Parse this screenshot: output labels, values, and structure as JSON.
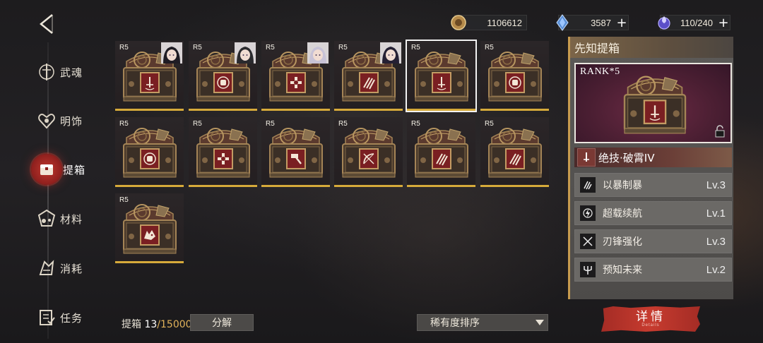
{
  "header": {
    "currencies": [
      {
        "icon": "coin-icon",
        "value": "1106612",
        "has_plus": false
      },
      {
        "icon": "crystal-icon",
        "value": "3587",
        "has_plus": true
      },
      {
        "icon": "stamina-icon",
        "value": "110/240",
        "has_plus": true
      }
    ]
  },
  "sidebar": {
    "items": [
      {
        "label": "武魂",
        "icon": "warrior-soul-icon",
        "active": false
      },
      {
        "label": "明饰",
        "icon": "ornament-icon",
        "active": false
      },
      {
        "label": "提箱",
        "icon": "chest-icon",
        "active": true
      },
      {
        "label": "材料",
        "icon": "materials-icon",
        "active": false
      },
      {
        "label": "消耗",
        "icon": "consumable-icon",
        "active": false
      },
      {
        "label": "任务",
        "icon": "task-icon",
        "active": false
      }
    ]
  },
  "grid": {
    "cards": [
      {
        "rank": "R5",
        "emblem": "sword",
        "portrait": true
      },
      {
        "rank": "R5",
        "emblem": "fist",
        "portrait": true
      },
      {
        "rank": "R5",
        "emblem": "cross",
        "portrait": true
      },
      {
        "rank": "R5",
        "emblem": "slash",
        "portrait": true
      },
      {
        "rank": "R5",
        "emblem": "sword",
        "portrait": false,
        "selected": true
      },
      {
        "rank": "R5",
        "emblem": "fist",
        "portrait": false
      },
      {
        "rank": "R5",
        "emblem": "fist",
        "portrait": false
      },
      {
        "rank": "R5",
        "emblem": "cross",
        "portrait": false
      },
      {
        "rank": "R5",
        "emblem": "hammer",
        "portrait": false
      },
      {
        "rank": "R5",
        "emblem": "bow",
        "portrait": false
      },
      {
        "rank": "R5",
        "emblem": "slash",
        "portrait": false
      },
      {
        "rank": "R5",
        "emblem": "slash",
        "portrait": false
      },
      {
        "rank": "R5",
        "emblem": "wolf",
        "portrait": false
      }
    ]
  },
  "footer": {
    "count_label": "提箱",
    "count_current": "13",
    "count_max": "/15000",
    "decompose_label": "分解",
    "sort_label": "稀有度排序"
  },
  "detail": {
    "title": "先知提箱",
    "rank_label": "RANK*5",
    "ultimate": "绝技·破霄IV",
    "skills": [
      {
        "name": "以暴制暴",
        "level": "Lv.3",
        "icon": "claw-icon"
      },
      {
        "name": "超载续航",
        "level": "Lv.1",
        "icon": "lightning-icon"
      },
      {
        "name": "刃锋强化",
        "level": "Lv.3",
        "icon": "blades-icon"
      },
      {
        "name": "预知未来",
        "level": "Lv.2",
        "icon": "trident-icon"
      }
    ],
    "button_label": "详情",
    "button_sub": "Details"
  },
  "colors": {
    "accent_gold": "#d6aa3a",
    "accent_red": "#c0382e",
    "panel_border": "#c79b4e"
  }
}
